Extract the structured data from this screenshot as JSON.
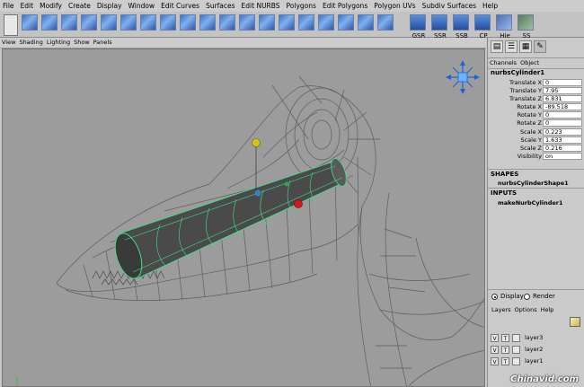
{
  "menubar": {
    "items": [
      "File",
      "Edit",
      "Modify",
      "Create",
      "Display",
      "Window",
      "Edit Curves",
      "Surfaces",
      "Edit NURBS",
      "Polygons",
      "Edit Polygons",
      "Polygon UVs",
      "Subdiv Surfaces",
      "Help"
    ]
  },
  "shelf": {
    "labeled_tools": [
      "GSR",
      "SSR",
      "SSB",
      "CP",
      "Hie",
      "SS"
    ]
  },
  "panel_menu": {
    "items": [
      "View",
      "Shading",
      "Lighting",
      "Show",
      "Panels"
    ]
  },
  "channel_box": {
    "menu": [
      "Channels",
      "Object"
    ],
    "object_name": "nurbsCylinder1",
    "attributes": [
      {
        "label": "Translate X",
        "value": "0"
      },
      {
        "label": "Translate Y",
        "value": "7.95"
      },
      {
        "label": "Translate Z",
        "value": "6.831"
      },
      {
        "label": "Rotate X",
        "value": "-89.518"
      },
      {
        "label": "Rotate Y",
        "value": "0"
      },
      {
        "label": "Rotate Z",
        "value": "0"
      },
      {
        "label": "Scale X",
        "value": "0.223"
      },
      {
        "label": "Scale Y",
        "value": "1.633"
      },
      {
        "label": "Scale Z",
        "value": "0.216"
      },
      {
        "label": "Visibility",
        "value": "on"
      }
    ],
    "shapes_header": "SHAPES",
    "shape_name": "nurbsCylinderShape1",
    "inputs_header": "INPUTS",
    "input_name": "makeNurbCylinder1"
  },
  "layer_editor": {
    "radio_display": "Display",
    "radio_render": "Render",
    "menu": [
      "Layers",
      "Options",
      "Help"
    ],
    "layers": [
      {
        "v": "V",
        "t": "T",
        "name": "layer3"
      },
      {
        "v": "V",
        "t": "T",
        "name": "layer2"
      },
      {
        "v": "V",
        "t": "T",
        "name": "layer1"
      }
    ]
  },
  "watermark": "Chinavid.com",
  "colors": {
    "viewport_bg": "#9c9c9c",
    "wire": "#5e5e5e",
    "selected_wire": "#3fe08a",
    "tool_blue": "#3d73c9"
  }
}
